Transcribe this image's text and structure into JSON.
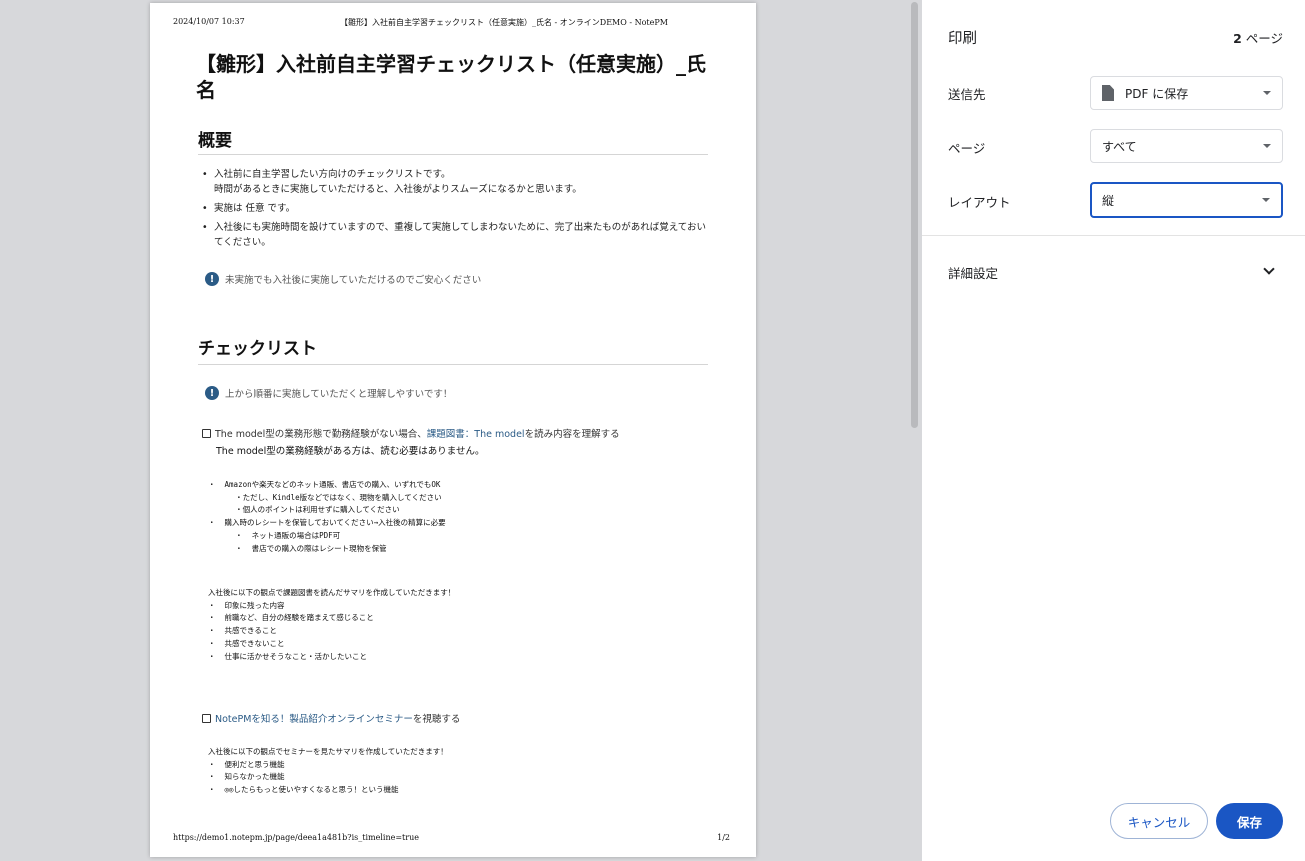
{
  "preview": {
    "header_date": "2024/10/07 10:37",
    "header_title": "【雛形】入社前自主学習チェックリスト（任意実施）_氏名 - オンラインDEMO - NotePM",
    "footer_url": "https://demo1.notepm.jp/page/deea1a481b?is_timeline=true",
    "footer_page": "1/2",
    "doc_title": "【雛形】入社前自主学習チェックリスト（任意実施）_氏名",
    "overview": {
      "heading": "概要",
      "bullets": [
        "入社前に自主学習したい方向けのチェックリストです。",
        "時間があるときに実施していただけると、入社後がよりスムーズになるかと思います。",
        "実施は 任意 です。",
        "入社後にも実施時間を設けていますので、重複して実施してしまわないために、完了出来たものがあれば覚えておいてください。"
      ],
      "note": "未実施でも入社後に実施していただけるのでご安心ください"
    },
    "checklist": {
      "heading": "チェックリスト",
      "note": "上から順番に実施していただくと理解しやすいです！",
      "task1": {
        "prefix": "The model型の業務形態で勤務経験がない場合、",
        "link": "課題図書：The model",
        "suffix": " を読み内容を理解する",
        "sub": "The model型の業務経験がある方は、読む必要はありません。",
        "purchase_lines": [
          "・  Amazonや楽天などのネット通販、書店での購入、いずれでもOK",
          "      ・ただし、Kindle版などではなく、現物を購入してください",
          "      ・個人のポイントは利用せずに購入してください",
          "・  購入時のレシートを保管しておいてください→入社後の精算に必要",
          "      ・  ネット通販の場合はPDF可",
          "      ・  書店での購入の際はレシート現物を保管"
        ],
        "summary_lines": [
          "入社後に以下の観点で課題図書を読んだサマリを作成していただきます！",
          "・  印象に残った内容",
          "・  前職など、自分の経験を踏まえて感じること",
          "・  共感できること",
          "・  共感できないこと",
          "・  仕事に活かせそうなこと・活かしたいこと"
        ]
      },
      "task2": {
        "link": "NotePMを知る！製品紹介オンラインセミナー",
        "suffix": "を視聴する",
        "summary_lines": [
          "入社後に以下の観点でセミナーを見たサマリを作成していただきます！",
          "・  便利だと思う機能",
          "・  知らなかった機能",
          "・  ◎◎したらもっと使いやすくなると思う！という機能"
        ]
      },
      "info_icon": "exclamation-icon"
    }
  },
  "panel": {
    "title": "印刷",
    "page_count_num": "2",
    "page_count_unit": " ページ",
    "destination": {
      "label": "送信先",
      "value": "PDF に保存",
      "icon": "file-icon"
    },
    "pages": {
      "label": "ページ",
      "value": "すべて"
    },
    "layout": {
      "label": "レイアウト",
      "value": "縦"
    },
    "more_settings": "詳細設定",
    "cancel": "キャンセル",
    "save": "保存"
  },
  "colors": {
    "accent": "#1a56c4",
    "link": "#2b5b86"
  }
}
